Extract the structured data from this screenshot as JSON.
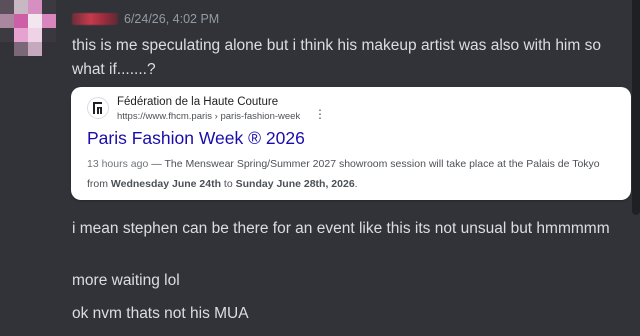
{
  "message": {
    "timestamp": "6/24/26, 4:02 PM",
    "lines": [
      "this is me speculating alone but i think his makeup artist was also with him so what if.......?",
      "i mean stephen can be there for an event like this its not unsual but hmmmmm",
      "more waiting lol",
      "ok nvm thats not his MUA"
    ]
  },
  "embed": {
    "site_name": "Fédération de la Haute Couture",
    "site_url": "https://www.fhcm.paris › paris-fashion-week",
    "title": "Paris Fashion Week ® 2026",
    "age": "13 hours ago",
    "snippet_pre": " — The Menswear Spring/Summer 2027 showroom session will take place at the Palais de Tokyo from ",
    "snippet_bold_1": "Wednesday June 24th",
    "snippet_mid": " to ",
    "snippet_bold_2": "Sunday June 28th, 2026",
    "snippet_post": "."
  },
  "icons": {
    "avatar": "avatar-icon",
    "site": "fhcm-logo-icon",
    "menu": "kebab-menu-icon"
  },
  "colors": {
    "background": "#313338",
    "text": "#dbdee1",
    "timestamp": "#949ba4",
    "link": "#1a0dab"
  }
}
